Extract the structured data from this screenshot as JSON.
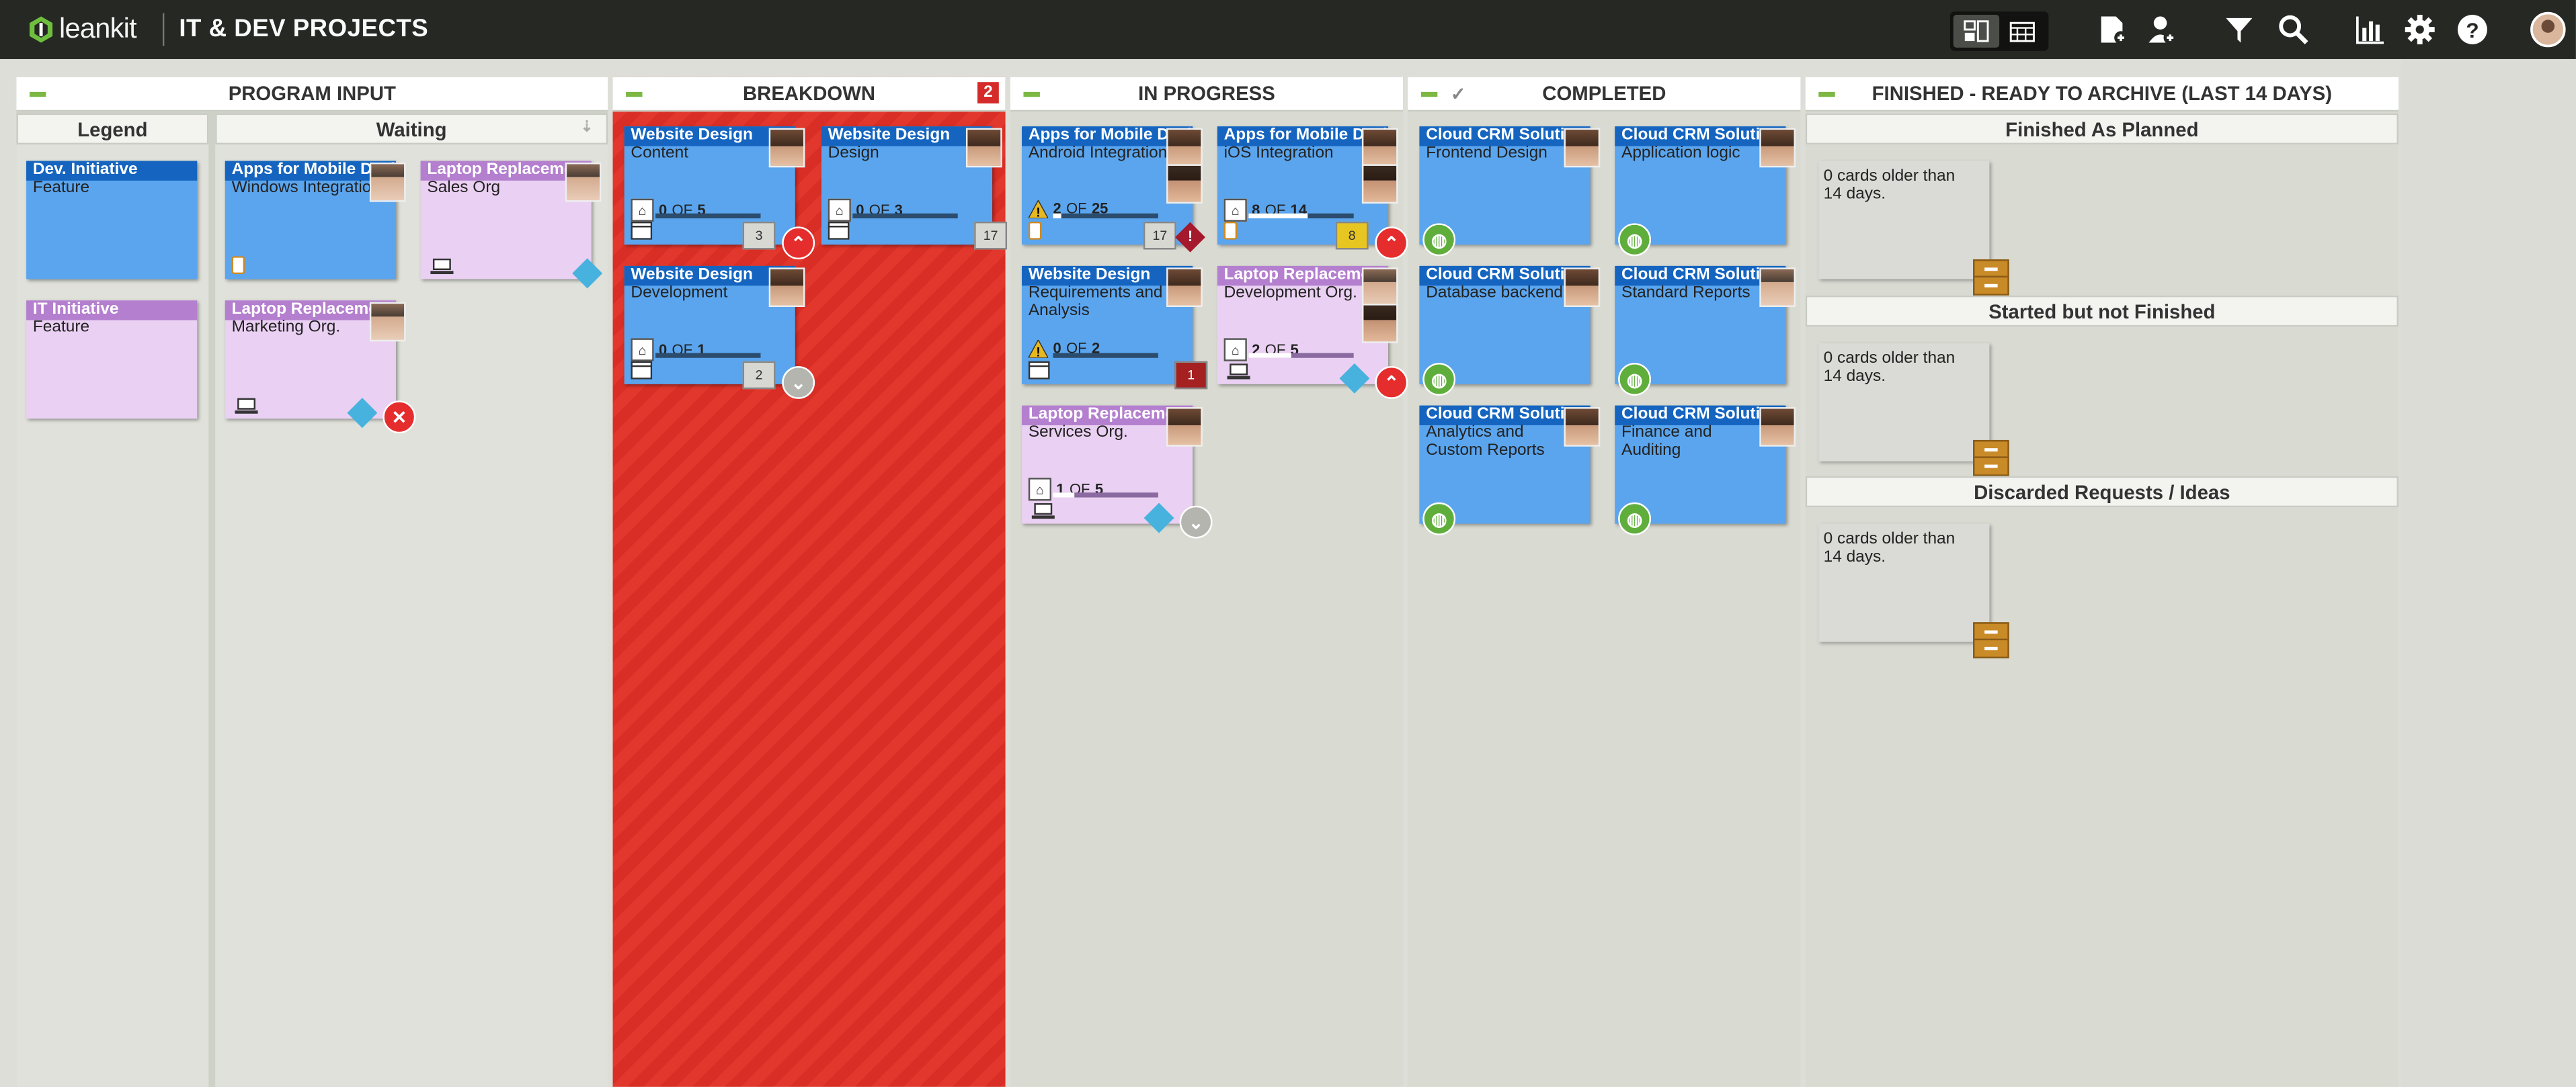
{
  "app": {
    "logo_text": "leankit",
    "board_title": "IT & DEV PROJECTS"
  },
  "toolbar": {
    "icons": [
      "board-view-icon",
      "calendar-view-icon",
      "add-card-icon",
      "add-user-icon",
      "filter-icon",
      "search-icon",
      "analytics-icon",
      "settings-icon",
      "help-icon",
      "user-avatar"
    ]
  },
  "lanes": {
    "program_input": {
      "title": "PROGRAM INPUT",
      "legend": "Legend",
      "waiting": "Waiting"
    },
    "breakdown": {
      "title": "BREAKDOWN",
      "wip": "2"
    },
    "in_progress": {
      "title": "IN PROGRESS"
    },
    "completed": {
      "title": "COMPLETED"
    },
    "finished": {
      "title": "FINISHED - READY TO ARCHIVE (LAST 14 DAYS)",
      "sub": [
        "Finished As Planned",
        "Started but not Finished",
        "Discarded Requests / Ideas"
      ],
      "archive_text": "0 cards older than 14 days."
    }
  },
  "legend_cards": [
    {
      "title": "Dev. Initiative",
      "sub": "Feature"
    },
    {
      "title": "IT Initiative",
      "sub": "Feature"
    }
  ],
  "waiting_cards": [
    {
      "title": "Apps for Mobile Devices",
      "sub": "Windows Integration"
    },
    {
      "title": "Laptop Replacement",
      "sub": "Sales Org"
    },
    {
      "title": "Laptop Replacement",
      "sub": "Marketing Org."
    }
  ],
  "breakdown_cards": [
    {
      "title": "Website Design",
      "sub": "Content",
      "tasks": "0",
      "of": "OF",
      "total": "5",
      "date": "3"
    },
    {
      "title": "Website Design",
      "sub": "Design",
      "tasks": "0",
      "of": "OF",
      "total": "3",
      "date": "17"
    },
    {
      "title": "Website Design",
      "sub": "Development",
      "tasks": "0",
      "of": "OF",
      "total": "1",
      "date": "2"
    }
  ],
  "progress_cards": [
    {
      "title": "Apps for Mobile Devices",
      "sub": "Android Integration",
      "tasks": "2",
      "of": "OF",
      "total": "25",
      "date": "17",
      "blocked": "!",
      "progress": 0.08
    },
    {
      "title": "Apps for Mobile Devices",
      "sub": "iOS Integration",
      "tasks": "8",
      "of": "OF",
      "total": "14",
      "date": "8",
      "progress": 0.57
    },
    {
      "title": "Website Design",
      "sub": "Requirements and Analysis",
      "tasks": "0",
      "of": "OF",
      "total": "2",
      "date": "1",
      "progress": 0
    },
    {
      "title": "Laptop Replacement",
      "sub": "Development Org.",
      "tasks": "2",
      "of": "OF",
      "total": "5",
      "progress": 0.4
    },
    {
      "title": "Laptop Replacement",
      "sub": "Services Org.",
      "tasks": "1",
      "of": "OF",
      "total": "5",
      "progress": 0.2
    }
  ],
  "completed_cards": [
    {
      "title": "Cloud CRM Solution",
      "sub": "Frontend Design"
    },
    {
      "title": "Cloud CRM Solution",
      "sub": "Application logic"
    },
    {
      "title": "Cloud CRM Solution",
      "sub": "Database backend"
    },
    {
      "title": "Cloud CRM Solution",
      "sub": "Standard Reports"
    },
    {
      "title": "Cloud CRM Solution",
      "sub": "Analytics and Custom Reports"
    },
    {
      "title": "Cloud CRM Solution",
      "sub": "Finance and Auditing"
    }
  ],
  "colors": {
    "topbar": "#262824",
    "dev_card": "#5aa5ee",
    "dev_header": "#1565c0",
    "it_card": "#ead0f2",
    "it_header": "#b47fce",
    "blocked_lane": "#e2372d",
    "accent_green": "#7cb843"
  }
}
